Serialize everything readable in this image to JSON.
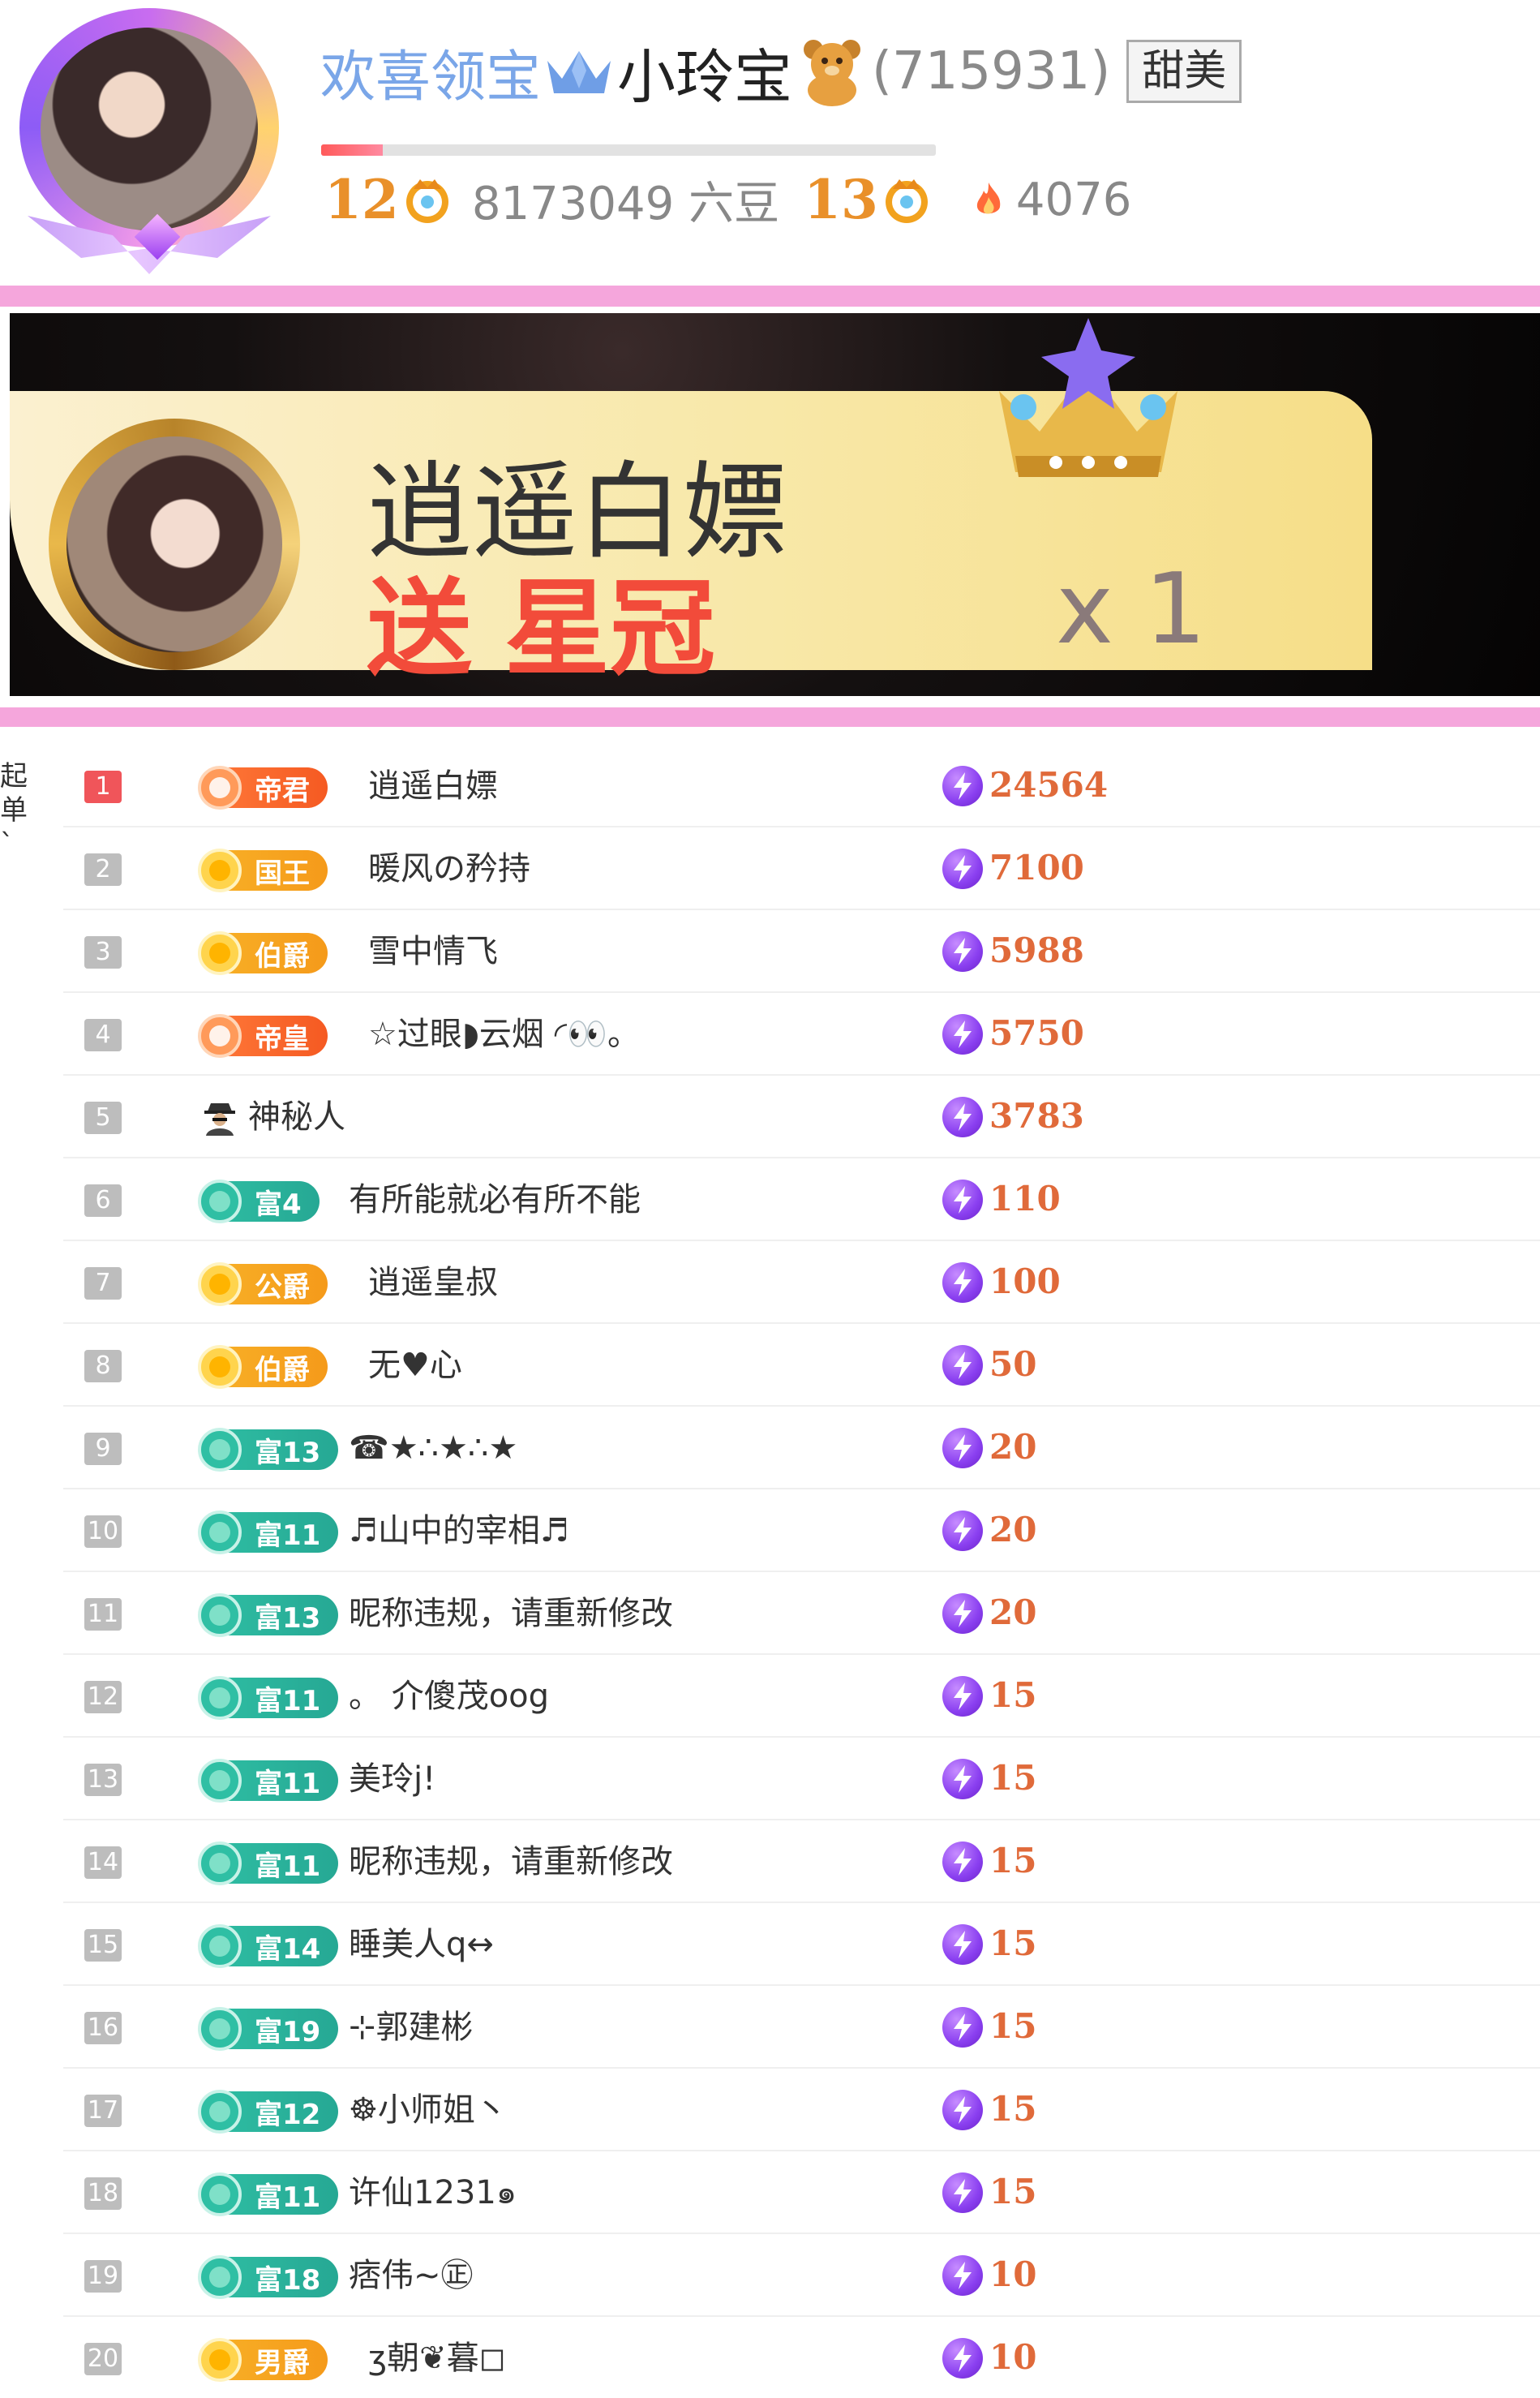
{
  "header": {
    "welcome_text": "欢喜领宝",
    "host_name": "小玲宝",
    "host_id": "(715931)",
    "tag": "甜美",
    "progress_fraction": 0.1,
    "level_current": "12",
    "beans_text": "8173049 六豆",
    "level_next": "13",
    "heat": "4076",
    "icons": [
      "avatar",
      "crown-icon",
      "bear-icon",
      "level-badge-icon",
      "flame-icon"
    ]
  },
  "banner": {
    "sender_name": "逍遥白嫖",
    "send_verb": "送",
    "gift_name": "星冠",
    "gift_count": "x 1",
    "icons": [
      "sender-avatar",
      "star-crown-icon"
    ]
  },
  "side_text": "起\n单\n`",
  "ranking": {
    "rows": [
      {
        "rank": "1",
        "badge_text": "帝君",
        "badge_style": "orange",
        "name": "逍遥白嫖",
        "score": "24564"
      },
      {
        "rank": "2",
        "badge_text": "国王",
        "badge_style": "gold",
        "name": "暖风の矜持",
        "score": "7100"
      },
      {
        "rank": "3",
        "badge_text": "伯爵",
        "badge_style": "gold",
        "name": "雪中情飞",
        "score": "5988"
      },
      {
        "rank": "4",
        "badge_text": "帝皇",
        "badge_style": "orange",
        "name": "☆过眼◗云烟 ◜👀。",
        "score": "5750"
      },
      {
        "rank": "5",
        "badge_text": "",
        "badge_style": "spy",
        "name": "神秘人",
        "score": "3783"
      },
      {
        "rank": "6",
        "badge_text": "富4",
        "badge_style": "teal",
        "name": "有所能就必有所不能",
        "score": "110"
      },
      {
        "rank": "7",
        "badge_text": "公爵",
        "badge_style": "gold",
        "name": "逍遥皇叔",
        "score": "100"
      },
      {
        "rank": "8",
        "badge_text": "伯爵",
        "badge_style": "gold",
        "name": "无♥心",
        "score": "50"
      },
      {
        "rank": "9",
        "badge_text": "富13",
        "badge_style": "teal",
        "name": "☎★∴★∴★",
        "score": "20"
      },
      {
        "rank": "10",
        "badge_text": "富11",
        "badge_style": "teal",
        "name": "♬山中的宰相♬",
        "score": "20"
      },
      {
        "rank": "11",
        "badge_text": "富13",
        "badge_style": "teal",
        "name": "昵称违规，请重新修改",
        "score": "20"
      },
      {
        "rank": "12",
        "badge_text": "富11",
        "badge_style": "teal",
        "name": "。 介傻茂oog",
        "score": "15"
      },
      {
        "rank": "13",
        "badge_text": "富11",
        "badge_style": "teal",
        "name": "美玲j!",
        "score": "15"
      },
      {
        "rank": "14",
        "badge_text": "富11",
        "badge_style": "teal",
        "name": "昵称违规，请重新修改",
        "score": "15"
      },
      {
        "rank": "15",
        "badge_text": "富14",
        "badge_style": "teal",
        "name": "睡美人q↔",
        "score": "15"
      },
      {
        "rank": "16",
        "badge_text": "富19",
        "badge_style": "teal",
        "name": "⊹郭建彬",
        "score": "15"
      },
      {
        "rank": "17",
        "badge_text": "富12",
        "badge_style": "teal",
        "name": "☸小师姐丶",
        "score": "15"
      },
      {
        "rank": "18",
        "badge_text": "富11",
        "badge_style": "teal",
        "name": "许仙1231๑",
        "score": "15"
      },
      {
        "rank": "19",
        "badge_text": "富18",
        "badge_style": "teal",
        "name": "痞伟~㊣",
        "score": "10"
      },
      {
        "rank": "20",
        "badge_text": "男爵",
        "badge_style": "gold",
        "name": "ʒ朝❦暮◻",
        "score": "10"
      }
    ]
  },
  "colors": {
    "accent_pink": "#f5a6dc",
    "welcome_blue": "#7aa6e8",
    "level_orange": "#e9902a",
    "score_orange": "#e06a3a",
    "rank_top_red": "#f0555a",
    "rank_gray": "#bdbdbd",
    "coin_purple": "#8a3ff0"
  }
}
